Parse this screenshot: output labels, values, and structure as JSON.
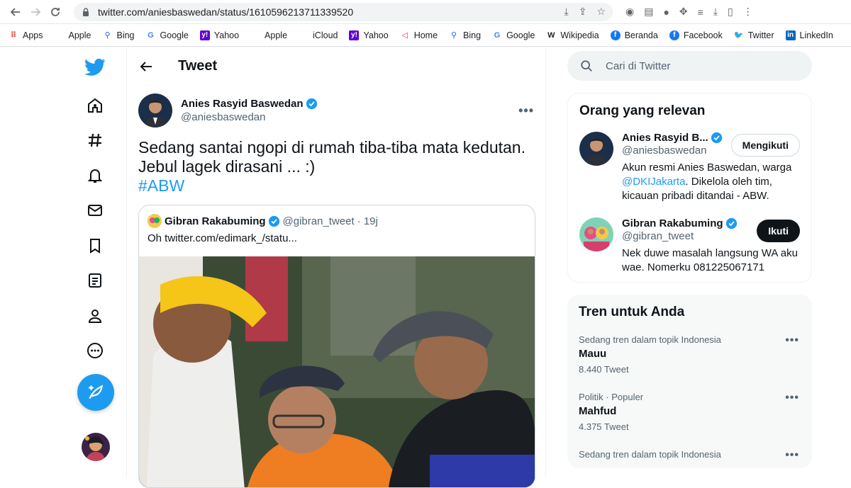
{
  "browser": {
    "url": "twitter.com/aniesbaswedan/status/1610596213711339520",
    "bookmarks": [
      "Apps",
      "Apple",
      "Bing",
      "Google",
      "Yahoo",
      "Apple",
      "iCloud",
      "Yahoo",
      "Home",
      "Bing",
      "Google",
      "Wikipedia",
      "Beranda",
      "Facebook",
      "Twitter",
      "LinkedIn"
    ]
  },
  "header": {
    "title": "Tweet"
  },
  "tweet": {
    "display_name": "Anies Rasyid Baswedan",
    "handle": "@aniesbaswedan",
    "text_line1": "Sedang santai ngopi di rumah tiba-tiba mata kedutan.",
    "text_line2": "Jebul lagek dirasani ... :)",
    "hashtag": "#ABW"
  },
  "quote": {
    "display_name": "Gibran Rakabuming",
    "handle": "@gibran_tweet",
    "time": "· 19j",
    "text": "Oh  twitter.com/edimark_/statu..."
  },
  "search": {
    "placeholder": "Cari di Twitter"
  },
  "relevant": {
    "title": "Orang yang relevan",
    "people": [
      {
        "name": "Anies Rasyid B...",
        "handle": "@aniesbaswedan",
        "bio_before": "Akun resmi Anies Baswedan, warga ",
        "bio_mention": "@DKIJakarta",
        "bio_after": ". Dikelola oleh tim, kicauan pribadi ditandai - ABW.",
        "button": "Mengikuti"
      },
      {
        "name": "Gibran Rakabuming",
        "handle": "@gibran_tweet",
        "bio": "Nek duwe masalah langsung WA aku wae. Nomerku 081225067171",
        "button": "Ikuti"
      }
    ]
  },
  "trends": {
    "title": "Tren untuk Anda",
    "items": [
      {
        "context": "Sedang tren dalam topik Indonesia",
        "name": "Mauu",
        "count": "8.440 Tweet"
      },
      {
        "context": "Politik · Populer",
        "name": "Mahfud",
        "count": "4.375 Tweet"
      },
      {
        "context": "Sedang tren dalam topik Indonesia",
        "name": "",
        "count": ""
      }
    ]
  },
  "colors": {
    "accent": "#1d9bf0",
    "text": "#0f1419",
    "muted": "#536471"
  }
}
